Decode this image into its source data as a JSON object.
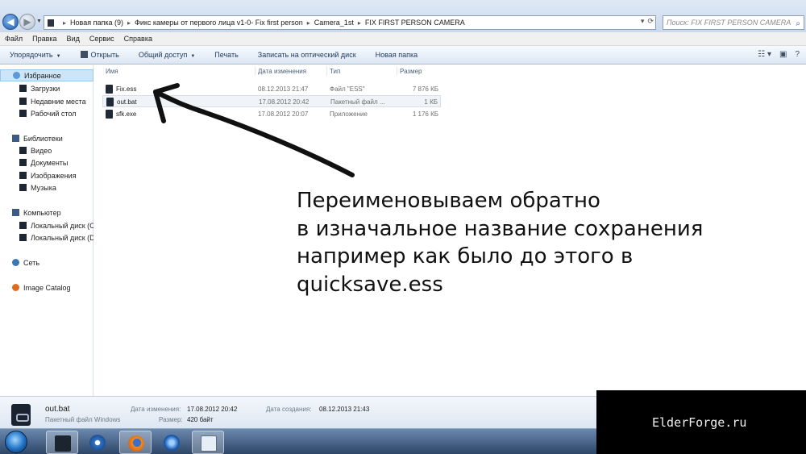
{
  "window": {
    "controls": {
      "minimize": "–",
      "maximize": "□",
      "close": "✕"
    }
  },
  "address": {
    "crumbs": [
      "Новая папка (9)",
      "Фикс камеры от первого лица v1-0- Fix first person",
      "Camera_1st",
      "FIX FIRST PERSON CAMERA"
    ],
    "search_placeholder": "Поиск: FIX FIRST PERSON CAMERA"
  },
  "menu": [
    "Файл",
    "Правка",
    "Вид",
    "Сервис",
    "Справка"
  ],
  "commands": {
    "organize": "Упорядочить",
    "open": "Открыть",
    "share": "Общий доступ",
    "print": "Печать",
    "burn": "Записать на оптический диск",
    "new_folder": "Новая папка"
  },
  "sidebar": {
    "favorites": "Избранное",
    "downloads": "Загрузки",
    "recent": "Недавние места",
    "desktop": "Рабочий стол",
    "libraries": "Библиотеки",
    "video": "Видео",
    "documents": "Документы",
    "images": "Изображения",
    "music": "Музыка",
    "computer": "Компьютер",
    "disk_c": "Локальный диск (C",
    "disk_d": "Локальный диск (D",
    "network": "Сеть",
    "image_catalog": "Image Catalog"
  },
  "columns": {
    "name": "Имя",
    "date": "Дата изменения",
    "type": "Тип",
    "size": "Размер"
  },
  "files": [
    {
      "name": "Fix.ess",
      "date": "08.12.2013 21:47",
      "type": "Файл \"ESS\"",
      "size": "7 876 КБ"
    },
    {
      "name": "out.bat",
      "date": "17.08.2012 20:42",
      "type": "Пакетный файл ...",
      "size": "1 КБ"
    },
    {
      "name": "sfk.exe",
      "date": "17.08.2012 20:07",
      "type": "Приложение",
      "size": "1 176 КБ"
    }
  ],
  "annotation": {
    "line1": "Переименовываем обратно",
    "line2": "в изначальное название сохранения",
    "line3": "например как было до этого в",
    "line4": "quicksave.ess"
  },
  "details": {
    "name": "out.bat",
    "type": "Пакетный файл Windows",
    "modified_label": "Дата изменения:",
    "modified": "17.08.2012 20:42",
    "size_label": "Размер:",
    "size": "420 байт",
    "created_label": "Дата создания:",
    "created": "08.12.2013 21:43"
  },
  "watermark": "ElderForge.ru"
}
